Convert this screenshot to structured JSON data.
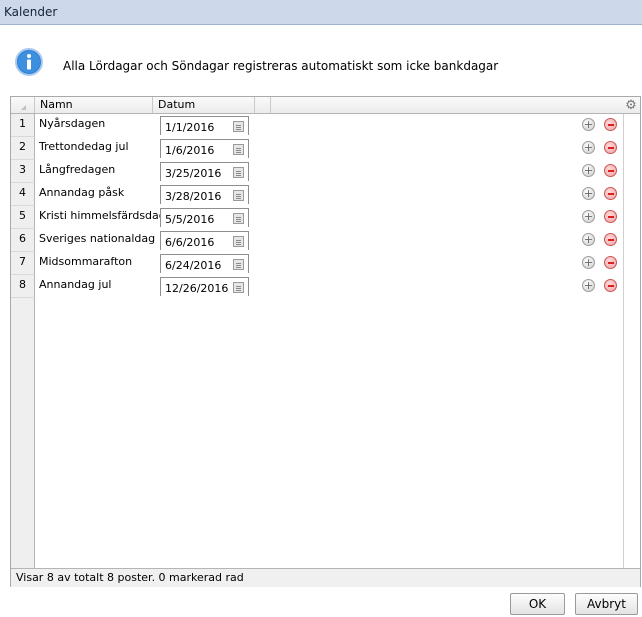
{
  "window": {
    "title": "Kalender"
  },
  "info": {
    "icon": "info-icon",
    "message": "Alla Lördagar och Söndagar registreras automatiskt som icke bankdagar"
  },
  "grid": {
    "columns": [
      "Namn",
      "Datum"
    ],
    "settings_icon": "gear-icon",
    "rows": [
      {
        "num": "1",
        "name": "Nyårsdagen",
        "date": "1/1/2016"
      },
      {
        "num": "2",
        "name": "Trettondedag jul",
        "date": "1/6/2016"
      },
      {
        "num": "3",
        "name": "Långfredagen",
        "date": "3/25/2016"
      },
      {
        "num": "4",
        "name": "Annandag påsk",
        "date": "3/28/2016"
      },
      {
        "num": "5",
        "name": "Kristi himmelsfärdsdag",
        "date": "5/5/2016"
      },
      {
        "num": "6",
        "name": "Sveriges nationaldag",
        "date": "6/6/2016"
      },
      {
        "num": "7",
        "name": "Midsommarafton",
        "date": "6/24/2016"
      },
      {
        "num": "8",
        "name": "Annandag jul",
        "date": "12/26/2016"
      }
    ],
    "status": "Visar 8 av totalt 8 poster. 0 markerad rad"
  },
  "buttons": {
    "ok": "OK",
    "cancel": "Avbryt"
  },
  "colors": {
    "titlebar": "#cdd9ea",
    "remove": "#d91f1f",
    "info_blue": "#2f7fd3"
  }
}
